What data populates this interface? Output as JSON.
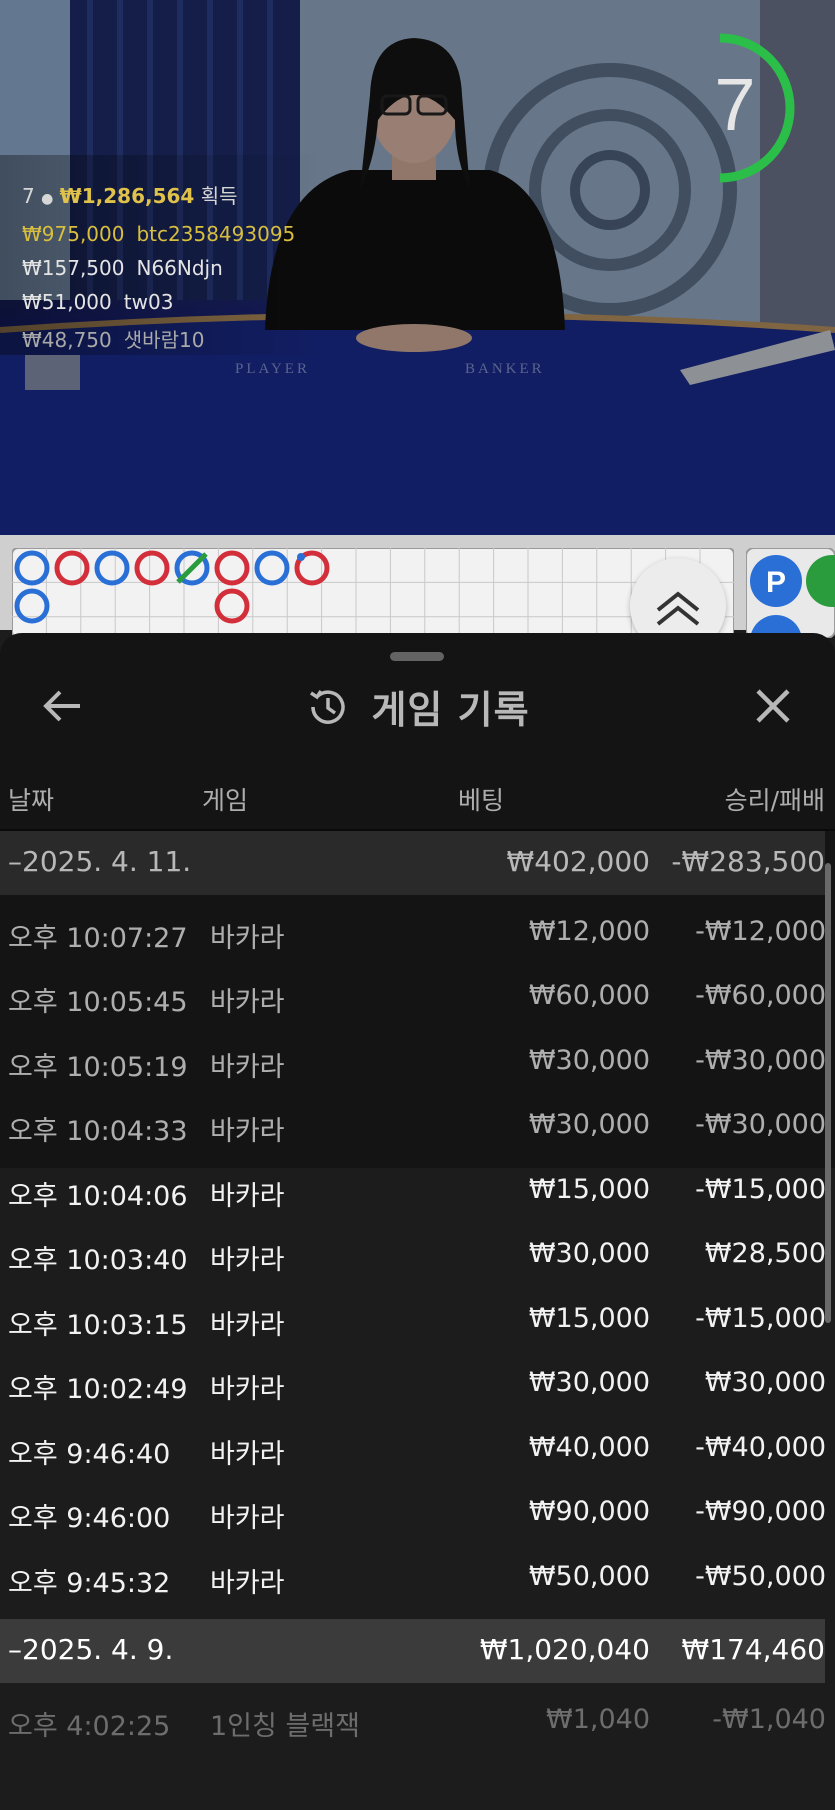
{
  "live": {
    "timer_value": "7",
    "winners_header": {
      "prefix": "7",
      "amount": "₩1,286,564",
      "suffix": "획득"
    },
    "winners": [
      {
        "amount": "₩975,000",
        "user": "btc2358493095"
      },
      {
        "amount": "₩157,500",
        "user": "N66Ndjn"
      },
      {
        "amount": "₩51,000",
        "user": "tw03"
      },
      {
        "amount": "₩48,750",
        "user": "샛바람10"
      }
    ],
    "table_labels": {
      "player": "PLAYER",
      "banker": "BANKER"
    },
    "side_road_labels": [
      "P",
      "P"
    ]
  },
  "roadmap": {
    "colors": {
      "player": "#2a6fd6",
      "banker": "#d22f3a",
      "tie": "#2a9c3d"
    },
    "cells": [
      {
        "col": 0,
        "row": 0,
        "type": "player"
      },
      {
        "col": 1,
        "row": 0,
        "type": "banker"
      },
      {
        "col": 2,
        "row": 0,
        "type": "player"
      },
      {
        "col": 3,
        "row": 0,
        "type": "banker"
      },
      {
        "col": 4,
        "row": 0,
        "type": "player-tie"
      },
      {
        "col": 5,
        "row": 0,
        "type": "banker"
      },
      {
        "col": 6,
        "row": 0,
        "type": "player"
      },
      {
        "col": 7,
        "row": 0,
        "type": "banker-pair"
      },
      {
        "col": 0,
        "row": 1,
        "type": "player"
      },
      {
        "col": 5,
        "row": 1,
        "type": "banker"
      }
    ]
  },
  "sheet": {
    "title": "게임 기록",
    "columns": {
      "date": "날짜",
      "game": "게임",
      "bet": "베팅",
      "result": "승리/패배"
    },
    "groups": [
      {
        "date": "–2025. 4. 11.",
        "bet_total": "₩402,000",
        "result_total": "-₩283,500",
        "rows": [
          {
            "time": "오후 10:07:27",
            "game": "바카라",
            "bet": "₩12,000",
            "result": "-₩12,000"
          },
          {
            "time": "오후 10:05:45",
            "game": "바카라",
            "bet": "₩60,000",
            "result": "-₩60,000"
          },
          {
            "time": "오후 10:05:19",
            "game": "바카라",
            "bet": "₩30,000",
            "result": "-₩30,000"
          },
          {
            "time": "오후 10:04:33",
            "game": "바카라",
            "bet": "₩30,000",
            "result": "-₩30,000"
          },
          {
            "time": "오후 10:04:06",
            "game": "바카라",
            "bet": "₩15,000",
            "result": "-₩15,000"
          },
          {
            "time": "오후 10:03:40",
            "game": "바카라",
            "bet": "₩30,000",
            "result": "₩28,500"
          },
          {
            "time": "오후 10:03:15",
            "game": "바카라",
            "bet": "₩15,000",
            "result": "-₩15,000"
          },
          {
            "time": "오후 10:02:49",
            "game": "바카라",
            "bet": "₩30,000",
            "result": "₩30,000"
          },
          {
            "time": "오후 9:46:40",
            "game": "바카라",
            "bet": "₩40,000",
            "result": "-₩40,000"
          },
          {
            "time": "오후 9:46:00",
            "game": "바카라",
            "bet": "₩90,000",
            "result": "-₩90,000"
          },
          {
            "time": "오후 9:45:32",
            "game": "바카라",
            "bet": "₩50,000",
            "result": "-₩50,000"
          }
        ]
      },
      {
        "date": "–2025. 4. 9.",
        "bet_total": "₩1,020,040",
        "result_total": "₩174,460",
        "rows": [
          {
            "time": "오후 4:02:25",
            "game": "1인칭 블랙잭",
            "bet": "₩1,040",
            "result": "-₩1,040"
          }
        ]
      }
    ]
  }
}
